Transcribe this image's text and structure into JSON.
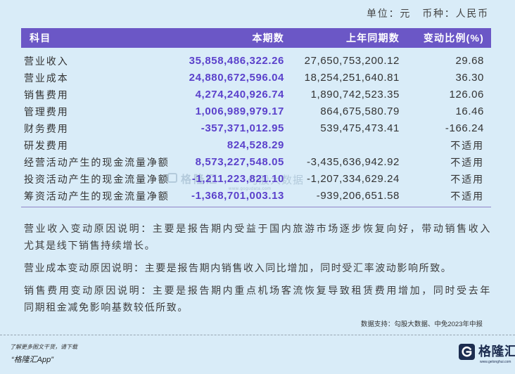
{
  "page": {
    "units_label": "单位：元",
    "currency_label": "币种：人民币"
  },
  "table": {
    "columns": {
      "subject": "科目",
      "current": "本期数",
      "prior": "上年同期数",
      "change": "变动比例(%)"
    },
    "rows": [
      {
        "label": "营业收入",
        "current": "35,858,486,322.26",
        "prior": "27,650,753,200.12",
        "change": "29.68"
      },
      {
        "label": "营业成本",
        "current": "24,880,672,596.04",
        "prior": "18,254,251,640.81",
        "change": "36.30"
      },
      {
        "label": "销售费用",
        "current": "4,274,240,926.74",
        "prior": "1,890,742,523.35",
        "change": "126.06"
      },
      {
        "label": "管理费用",
        "current": "1,006,989,979.17",
        "prior": "864,675,580.79",
        "change": "16.46"
      },
      {
        "label": "财务费用",
        "current": "-357,371,012.95",
        "prior": "539,475,473.41",
        "change": "-166.24"
      },
      {
        "label": "研发费用",
        "current": "824,528.29",
        "change": "不适用"
      },
      {
        "label": "经营活动产生的现金流量净额",
        "current": "8,573,227,548.05",
        "prior": "-3,435,636,942.92",
        "change": "不适用"
      },
      {
        "label": "投资活动产生的现金流量净额",
        "current": "-1,211,223,821.10",
        "prior": "-1,207,334,629.24",
        "change": "不适用"
      },
      {
        "label": "筹资活动产生的现金流量净额",
        "current": "-1,368,701,003.13",
        "prior": "-939,206,651.58",
        "change": "不适用"
      }
    ]
  },
  "notes": [
    {
      "lines": [
        "营业收入变动原因说明：主要是报告期内受益于国内旅游市场逐步恢复向好，带动销售收入",
        "尤其是线下销售持续增长。"
      ]
    },
    {
      "lines": [
        "营业成本变动原因说明：主要是报告期内销售收入同比增加，同时受汇率波动影响所致。"
      ]
    },
    {
      "lines": [
        "销售费用变动原因说明：主要是报告期内重点机场客流恢复导致租赁费用增加，同时受去年",
        "同期租金减免影响基数较低所致。"
      ]
    }
  ],
  "source": "数据支持：勾股大数据、中免2023年中报",
  "watermark": {
    "brand": "格隆汇",
    "name": "勾股大数据",
    "url": "www.gogudata.com"
  },
  "footer": {
    "prompt": "了解更多图文干货，请下载",
    "app": "“格隆汇App”",
    "logo_text": "格隆汇",
    "logo_url": "www.gelonghui.com",
    "logo_icon": "g-logo-icon"
  },
  "colors": {
    "background": "#d9ecf8",
    "header": "#6b57c6",
    "accent": "#5b41cb",
    "rule": "#8f84c8"
  }
}
